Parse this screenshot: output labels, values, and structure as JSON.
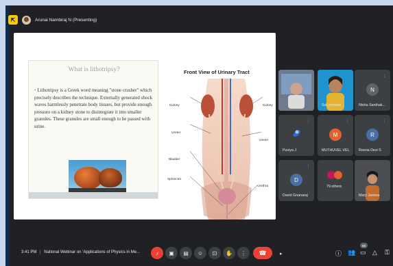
{
  "top_bar": {
    "presenter": "Arunai Nambiraj N (Presenting)"
  },
  "slide": {
    "title": "What is lithotripsy?",
    "body": "Lithotripsy is a Greek word meaning \"stone crusher\" which precisely describes the technique. Externally generated shock waves harmlessly penetrate body tissues, but provide enough pressure on a kidney stone to disintegrate it into smaller granules. These granules are small enough to be passed with urine.",
    "diagram": {
      "title": "Front View of Urinary Tract",
      "labels": {
        "kidney_left": "Kidney",
        "kidney_right": "Kidney",
        "ureter_left": "Ureter",
        "ureter_right": "Ureter",
        "bladder": "Bladder",
        "sphincter": "Sphincter",
        "urethra": "Urethra"
      }
    }
  },
  "participants": [
    {
      "name": "",
      "initial": ""
    },
    {
      "name": "Ssk physics",
      "initial": ""
    },
    {
      "name": "Nisha Santhak...",
      "initial": "N",
      "color": "#5f6368"
    },
    {
      "name": "Puviya J",
      "initial": ""
    },
    {
      "name": "MUTHUVEL VEL",
      "initial": "M",
      "color": "#e2622f"
    },
    {
      "name": "Reena Devi S",
      "initial": "R",
      "color": "#4a6fa5"
    },
    {
      "name": "David Gnanaraj",
      "initial": "D",
      "color": "#4a6fa5"
    },
    {
      "name": "79 others",
      "initial": ""
    },
    {
      "name": "Mary Jamina",
      "initial": ""
    }
  ],
  "bottom_bar": {
    "time": "3:41 PM",
    "separator": "|",
    "meeting_title": "National Webinar on 'Applications of Physics in Me...",
    "participant_count": "88"
  },
  "colors": {
    "hangup": "#ea4335",
    "muted_mic": "#ea4335",
    "presenting_chip": "#f9c80e"
  }
}
